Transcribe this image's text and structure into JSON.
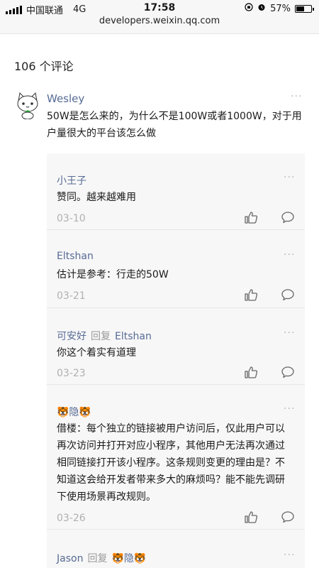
{
  "status_bar": {
    "carrier": "中国联通",
    "network": "4G",
    "time": "17:58",
    "battery": "57%",
    "battery_level": 0.57,
    "url": "developers.weixin.qq.com"
  },
  "comments_count": "106 个评论",
  "main_comment": {
    "author": "Wesley",
    "text": "50W是怎么来的，为什么不是100W或者1000W，对于用户量很大的平台该怎么做",
    "more_label": "···"
  },
  "replies": [
    {
      "name": "小王子",
      "text": "赞同。越来越难用",
      "date": "03-10"
    },
    {
      "name": "Eltshan",
      "text": "估计是参考：行走的50W",
      "date": "03-21"
    },
    {
      "name": "可安好",
      "reply_word": "回复",
      "target": "Eltshan",
      "text": "你这个着实有道理",
      "date": "03-23"
    },
    {
      "name": "🐯隐🐯",
      "text": "借楼：每个独立的链接被用户访问后，仅此用户可以再次访问并打开对应小程序，其他用户无法再次通过相同链接打开该小程序。这条规则变更的理由是？不知道这会给开发者带来多大的麻烦吗？能不能先调研下使用场景再改规则。",
      "date": "03-26"
    },
    {
      "name": "Jason",
      "reply_word": "回复",
      "target": "🐯隐🐯"
    }
  ],
  "colors": {
    "link_blue": "#576b95",
    "reply_bg": "#f7f7f7",
    "muted": "#b0b0b0"
  },
  "icons": {
    "like": "thumbs-up-icon",
    "reply": "comment-bubble-icon",
    "more": "more-dots-icon"
  }
}
